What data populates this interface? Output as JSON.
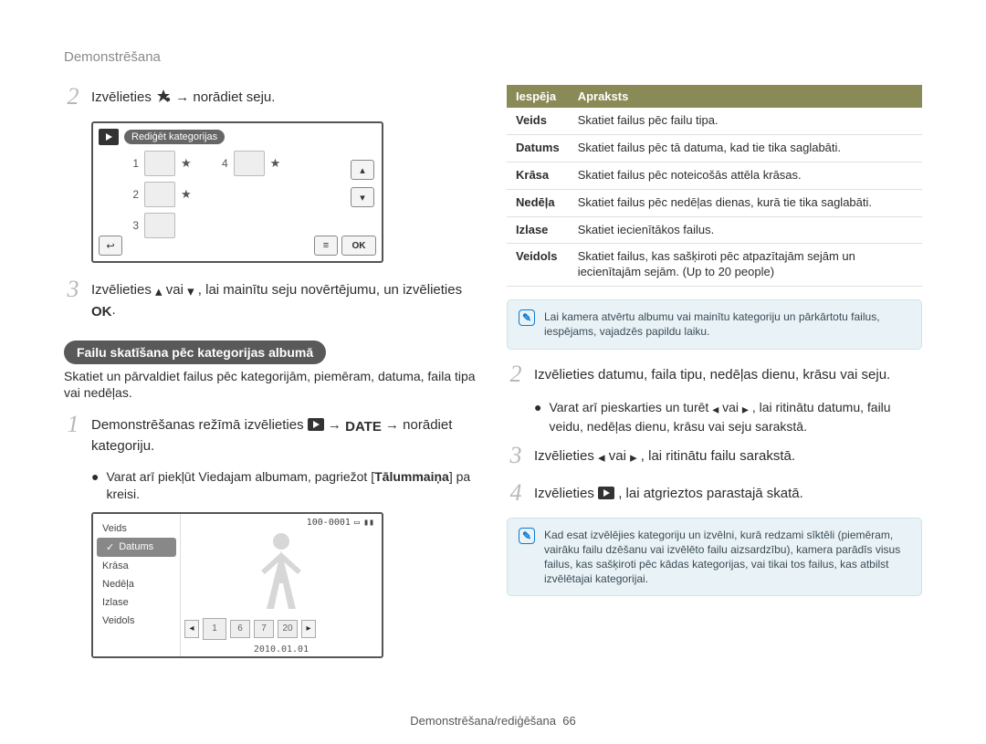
{
  "header": "Demonstrēšana",
  "left": {
    "step2": {
      "pre": "Izvēlieties ",
      "post": " → norādiet seju."
    },
    "screen1": {
      "title": "Rediģēt kategorijas",
      "rows": [
        "1",
        "2",
        "3",
        "4"
      ],
      "ok": "OK"
    },
    "step3": {
      "pre": "Izvēlieties ",
      "mid": " vai ",
      "post": ", lai mainītu seju novērtējumu, un izvēlieties ",
      "end": "."
    },
    "section_title": "Failu skatīšana pēc kategorijas albumā",
    "section_desc": "Skatiet un pārvaldiet failus pēc kategorijām, piemēram, datuma, faila tipa vai nedēļas.",
    "stepA": {
      "pre": "Demonstrēšanas režīmā izvēlieties ",
      "date": "DATE",
      "post": " → norādiet kategoriju."
    },
    "bulletA": {
      "text_pre": "Varat arī piekļūt Viedajam albumam, pagriežot [",
      "bold": "Tālummaiņa",
      "text_post": "] pa kreisi."
    },
    "screen2": {
      "menu": [
        "Veids",
        "Datums",
        "Krāsa",
        "Nedēļa",
        "Izlase",
        "Veidols"
      ],
      "selected_index": 1,
      "info": "100-0001",
      "thumbs": [
        "1",
        "6",
        "7",
        "20"
      ],
      "date": "2010.01.01"
    }
  },
  "right": {
    "table": {
      "head": [
        "Iespēja",
        "Apraksts"
      ],
      "rows": [
        {
          "k": "Veids",
          "v": "Skatiet failus pēc failu tipa."
        },
        {
          "k": "Datums",
          "v": "Skatiet failus pēc tā datuma, kad tie tika saglabāti."
        },
        {
          "k": "Krāsa",
          "v": "Skatiet failus pēc noteicošās attēla krāsas."
        },
        {
          "k": "Nedēļa",
          "v": "Skatiet failus pēc nedēļas dienas, kurā tie tika saglabāti."
        },
        {
          "k": "Izlase",
          "v": "Skatiet iecienītākos failus."
        },
        {
          "k": "Veidols",
          "v": "Skatiet failus, kas sašķiroti pēc atpazītajām sejām un iecienītajām sejām. (Up to 20 people)"
        }
      ]
    },
    "note1": "Lai kamera atvērtu albumu vai mainītu kategoriju un pārkārtotu failus, iespējams, vajadzēs papildu laiku.",
    "step2": "Izvēlieties datumu, faila tipu, nedēļas dienu, krāsu vai seju.",
    "bullet2": {
      "pre": "Varat arī pieskarties un turēt ",
      "mid": " vai ",
      "post": ", lai ritinātu datumu, failu veidu, nedēļas dienu, krāsu vai seju sarakstā."
    },
    "step3": {
      "pre": "Izvēlieties ",
      "mid": " vai ",
      "post": ", lai ritinātu failu sarakstā."
    },
    "step4": {
      "pre": "Izvēlieties ",
      "post": ", lai atgrieztos parastajā skatā."
    },
    "note2": "Kad esat izvēlējies kategoriju un izvēlni, kurā redzami sīktēli (piemēram, vairāku failu dzēšanu vai izvēlēto failu aizsardzību), kamera parādīs visus failus, kas sašķiroti pēc kādas kategorijas, vai tikai tos failus, kas atbilst izvēlētajai kategorijai."
  },
  "footer": {
    "label": "Demonstrēšana/rediģēšana",
    "page": "66"
  }
}
